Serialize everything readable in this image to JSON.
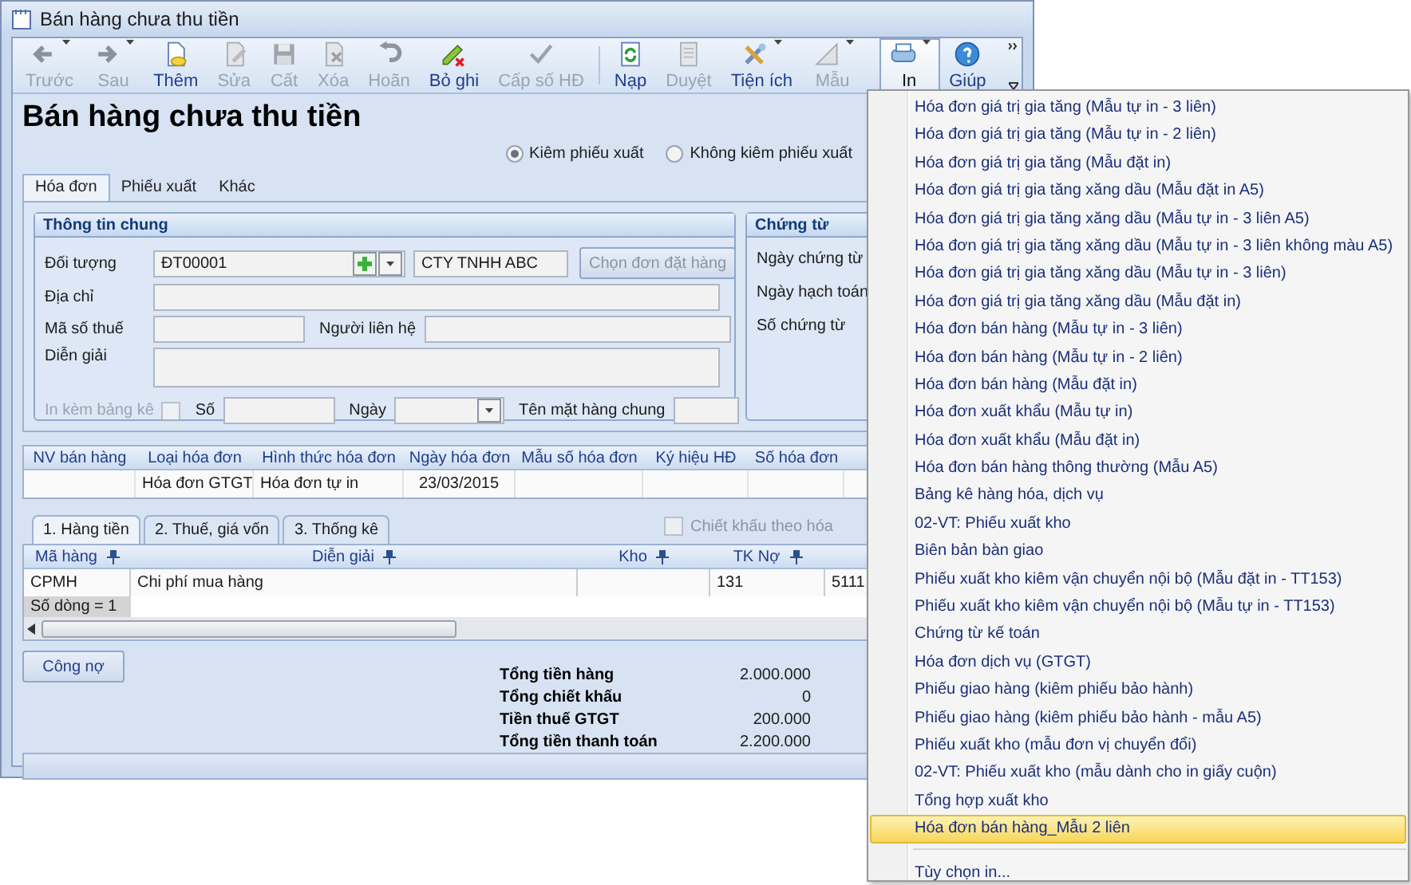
{
  "window": {
    "title": "Bán hàng chưa thu tiền"
  },
  "toolbar": [
    {
      "label": "Trước",
      "disabled": true,
      "dropdown": true,
      "pressed": false
    },
    {
      "label": "Sau",
      "disabled": true,
      "dropdown": true,
      "pressed": false
    },
    {
      "label": "Thêm",
      "disabled": false,
      "dropdown": false,
      "pressed": false
    },
    {
      "label": "Sửa",
      "disabled": true,
      "dropdown": false,
      "pressed": false
    },
    {
      "label": "Cất",
      "disabled": true,
      "dropdown": false,
      "pressed": false
    },
    {
      "label": "Xóa",
      "disabled": true,
      "dropdown": false,
      "pressed": false
    },
    {
      "label": "Hoãn",
      "disabled": true,
      "dropdown": false,
      "pressed": false
    },
    {
      "label": "Bỏ ghi",
      "disabled": false,
      "dropdown": false,
      "pressed": false
    },
    {
      "label": "Cấp số HĐ",
      "disabled": true,
      "dropdown": false,
      "pressed": false
    },
    {
      "label": "Nạp",
      "disabled": false,
      "dropdown": false,
      "pressed": false
    },
    {
      "label": "Duyệt",
      "disabled": true,
      "dropdown": false,
      "pressed": false
    },
    {
      "label": "Tiện ích",
      "disabled": false,
      "dropdown": true,
      "pressed": false
    },
    {
      "label": "Mẫu",
      "disabled": true,
      "dropdown": true,
      "pressed": false
    },
    {
      "label": "In",
      "disabled": false,
      "dropdown": true,
      "pressed": true
    },
    {
      "label": "Giúp",
      "disabled": false,
      "dropdown": false,
      "pressed": false
    }
  ],
  "heading": "Bán hàng chưa thu tiền",
  "options": [
    {
      "label": "Kiêm phiếu xuất",
      "selected": true
    },
    {
      "label": "Không kiêm phiếu xuất",
      "selected": false
    }
  ],
  "tabs": [
    {
      "label": "Hóa đơn",
      "selected": true
    },
    {
      "label": "Phiếu xuất",
      "selected": false
    },
    {
      "label": "Khác",
      "selected": false
    }
  ],
  "general": {
    "title": "Thông tin chung",
    "customer": {
      "label": "Đối tượng",
      "code": "ĐT00001",
      "name": "CTY TNHH ABC"
    },
    "order_button": {
      "label": "Chọn đơn đặt hàng",
      "disabled": true
    },
    "address": {
      "label": "Địa chỉ"
    },
    "tax_code": {
      "label": "Mã số thuế"
    },
    "contact": {
      "label": "Người liên hệ"
    },
    "description": {
      "label": "Diễn giải"
    },
    "attach_list": {
      "label": "In kèm bảng kê",
      "checked": false,
      "disabled": true
    },
    "number": {
      "label": "Số"
    },
    "date": {
      "label": "Ngày"
    },
    "item_name": {
      "label": "Tên mặt hàng chung"
    }
  },
  "voucher": {
    "title": "Chứng từ",
    "labels": [
      "Ngày chứng từ",
      "Ngày hạch toán",
      "Số chứng từ"
    ]
  },
  "invoice_grid": {
    "columns": [
      "NV bán hàng",
      "Loại hóa đơn",
      "Hình thức hóa đơn",
      "Ngày hóa đơn",
      "Mẫu số hóa đơn",
      "Ký hiệu HĐ",
      "Số hóa đơn"
    ],
    "rows": [
      [
        null,
        "Hóa đơn GTGT",
        "Hóa đơn tự in",
        "23/03/2015",
        null,
        null,
        null
      ]
    ]
  },
  "detail_tabs": [
    {
      "label": "1. Hàng tiền",
      "selected": true
    },
    {
      "label": "2. Thuế, giá vốn",
      "selected": false
    },
    {
      "label": "3. Thống kê",
      "selected": false
    }
  ],
  "discount_option": {
    "label": "Chiết khấu theo hóa",
    "checked": false,
    "disabled": true
  },
  "detail_grid": {
    "columns": [
      "Mã hàng",
      "Diễn giải",
      "Kho",
      "TK Nợ"
    ],
    "rows": [
      [
        "CPMH",
        "Chi phí mua hàng",
        null,
        "131",
        "5111"
      ]
    ],
    "footer": "Số dòng = 1"
  },
  "debt_button": "Công nợ",
  "totals": [
    {
      "label": "Tổng tiền hàng",
      "value": "2.000.000"
    },
    {
      "label": "Tổng chiết khấu",
      "value": "0"
    },
    {
      "label": "Tiền thuế GTGT",
      "value": "200.000"
    },
    {
      "label": "Tổng tiền thanh toán",
      "value": "2.200.000"
    }
  ],
  "print_menu": {
    "items": [
      {
        "label": "Hóa đơn giá trị gia tăng (Mẫu tự in - 3 liên)",
        "selected": false
      },
      {
        "label": "Hóa đơn giá trị gia tăng (Mẫu tự in - 2 liên)",
        "selected": false
      },
      {
        "label": "Hóa đơn giá trị gia tăng (Mẫu đặt in)",
        "selected": false
      },
      {
        "label": "Hóa đơn giá trị gia tăng xăng dầu (Mẫu đặt in A5)",
        "selected": false
      },
      {
        "label": "Hóa đơn giá trị gia tăng xăng dầu (Mẫu tự in - 3 liên A5)",
        "selected": false
      },
      {
        "label": "Hóa đơn giá trị gia tăng xăng dầu (Mẫu tự in - 3 liên không màu A5)",
        "selected": false
      },
      {
        "label": "Hóa đơn giá trị gia tăng xăng dầu (Mẫu tự in - 3 liên)",
        "selected": false
      },
      {
        "label": "Hóa đơn giá trị gia tăng xăng dầu (Mẫu đặt in)",
        "selected": false
      },
      {
        "label": "Hóa đơn bán hàng (Mẫu tự in - 3 liên)",
        "selected": false
      },
      {
        "label": "Hóa đơn bán hàng (Mẫu tự in - 2 liên)",
        "selected": false
      },
      {
        "label": "Hóa đơn bán hàng (Mẫu đặt in)",
        "selected": false
      },
      {
        "label": "Hóa đơn xuất khẩu (Mẫu tự in)",
        "selected": false
      },
      {
        "label": "Hóa đơn xuất khẩu (Mẫu đặt in)",
        "selected": false
      },
      {
        "label": "Hóa đơn bán hàng thông thường (Mẫu A5)",
        "selected": false
      },
      {
        "label": "Bảng kê hàng hóa, dịch vụ",
        "selected": false
      },
      {
        "label": "02-VT: Phiếu xuất kho",
        "selected": false
      },
      {
        "label": "Biên bản bàn giao",
        "selected": false
      },
      {
        "label": "Phiếu xuất kho kiêm vận chuyển nội bộ (Mẫu đặt in - TT153)",
        "selected": false
      },
      {
        "label": "Phiếu xuất kho kiêm vận chuyển nội bộ (Mẫu tự in - TT153)",
        "selected": false
      },
      {
        "label": "Chứng từ kế toán",
        "selected": false
      },
      {
        "label": "Hóa đơn dịch vụ (GTGT)",
        "selected": false
      },
      {
        "label": "Phiếu giao hàng (kiêm phiếu bảo hành)",
        "selected": false
      },
      {
        "label": "Phiếu giao hàng (kiêm phiếu bảo hành - mẫu A5)",
        "selected": false
      },
      {
        "label": "Phiếu xuất kho (mẫu đơn vị chuyển đổi)",
        "selected": false
      },
      {
        "label": "02-VT: Phiếu xuất kho (mẫu dành cho in giấy cuộn)",
        "selected": false
      },
      {
        "label": "Tổng hợp xuất kho",
        "selected": false
      },
      {
        "label": "Hóa đơn bán hàng_Mẫu 2 liên",
        "selected": true
      }
    ],
    "extra_items": [
      {
        "label": "Tùy chọn in...",
        "selected": false
      }
    ]
  }
}
